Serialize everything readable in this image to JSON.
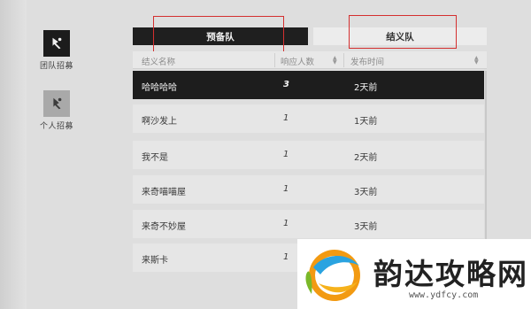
{
  "sidebar": {
    "items": [
      {
        "label": "团队招募",
        "icon": "team-recruit-icon",
        "active": true
      },
      {
        "label": "个人招募",
        "icon": "personal-recruit-icon",
        "active": false
      }
    ]
  },
  "tabs": [
    {
      "label": "预备队",
      "active": true
    },
    {
      "label": "结义队",
      "active": false
    }
  ],
  "table": {
    "headers": [
      "结义名称",
      "响应人数",
      "发布时间"
    ],
    "rows": [
      {
        "name": "哈哈哈哈",
        "count": "3",
        "time": "2天前",
        "selected": true
      },
      {
        "name": "啊沙发上",
        "count": "1",
        "time": "1天前",
        "selected": false
      },
      {
        "name": "我不是",
        "count": "1",
        "time": "2天前",
        "selected": false
      },
      {
        "name": "来奇喵喵屋",
        "count": "1",
        "time": "3天前",
        "selected": false
      },
      {
        "name": "来奇不妙屋",
        "count": "1",
        "time": "3天前",
        "selected": false
      },
      {
        "name": "来斯卡",
        "count": "1",
        "time": "",
        "selected": false
      }
    ]
  },
  "watermark": {
    "text": "韵达攻略网",
    "url": "www.ydfcy.com"
  },
  "colors": {
    "highlight_box": "#d42f2f",
    "selected_row": "#1d1d1d",
    "active_tab": "#1f1f1f"
  }
}
